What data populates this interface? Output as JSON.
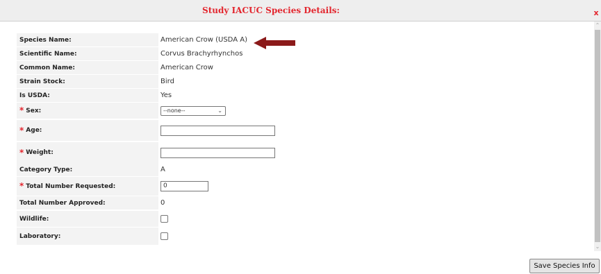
{
  "dialog": {
    "title": "Study IACUC Species Details:",
    "close_label": "x"
  },
  "fields": {
    "species_name": {
      "label": "Species Name:",
      "value": "American Crow (USDA A)"
    },
    "scientific_name": {
      "label": "Scientific Name:",
      "value": "Corvus Brachyrhynchos"
    },
    "common_name": {
      "label": "Common Name:",
      "value": "American Crow"
    },
    "strain_stock": {
      "label": "Strain Stock:",
      "value": "Bird"
    },
    "is_usda": {
      "label": "Is USDA:",
      "value": "Yes"
    },
    "sex": {
      "label": "Sex:",
      "required_mark": "*",
      "selected": "--none--"
    },
    "age": {
      "label": "Age:",
      "required_mark": "*",
      "value": ""
    },
    "weight": {
      "label": "Weight:",
      "required_mark": "*",
      "value": ""
    },
    "category_type": {
      "label": "Category Type:",
      "value": "A"
    },
    "total_requested": {
      "label": "Total Number Requested:",
      "required_mark": "*",
      "value": "0"
    },
    "total_approved": {
      "label": "Total Number Approved:",
      "value": "0"
    },
    "wildlife": {
      "label": "Wildlife:",
      "checked": false
    },
    "laboratory": {
      "label": "Laboratory:",
      "checked": false
    }
  },
  "annotation": {
    "icon": "arrow-left-icon",
    "color": "#8b1a1a"
  },
  "footer": {
    "save_label": "Save Species Info"
  },
  "colors": {
    "title": "#e3262e",
    "required": "#e3262e",
    "label_bg": "#f3f3f3"
  }
}
